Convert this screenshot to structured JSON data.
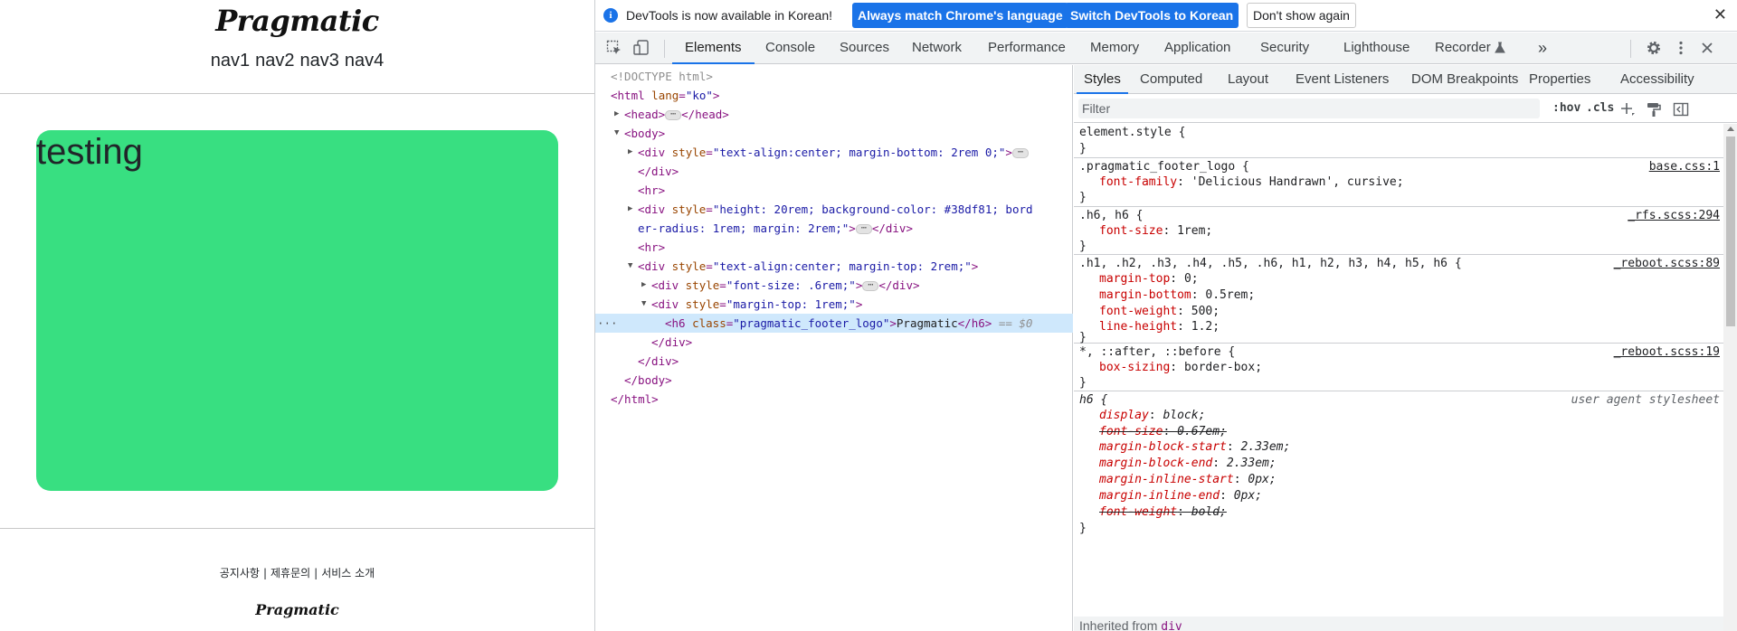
{
  "page": {
    "logo_top": "Pragmatic",
    "nav": [
      "nav1",
      "nav2",
      "nav3",
      "nav4"
    ],
    "box_text": "testing",
    "box_color": "#38df81",
    "footer_links": [
      "공지사항",
      "제휴문의",
      "서비스 소개"
    ],
    "footer_separator": "|",
    "logo_bottom": "Pragmatic"
  },
  "devtools": {
    "infobar": {
      "message": "DevTools is now available in Korean!",
      "btn_match": "Always match Chrome's language",
      "btn_switch": "Switch DevTools to Korean",
      "btn_dismiss": "Don't show again",
      "close": "✕"
    },
    "tabs": [
      "Elements",
      "Console",
      "Sources",
      "Network",
      "Performance",
      "Memory",
      "Application",
      "Security",
      "Lighthouse",
      "Recorder"
    ],
    "more_tabs": "»",
    "elements_tree": {
      "doctype": "<!DOCTYPE html>",
      "html_open_tag": "<html",
      "html_lang_attr": "lang",
      "html_lang_val": "\"ko\"",
      "head": "<head>",
      "head_close": "</head>",
      "body": "<body>",
      "div1_tag": "<div",
      "div1_attr": "style",
      "div1_val": "\"text-align:center; margin-bottom: 2rem 0;\"",
      "div_close": "</div>",
      "hr": "<hr>",
      "div2_val_1": "\"height: 20rem; background-color: #38df81; bord",
      "div2_val_2": "er-radius: 1rem; margin: 2rem;\"",
      "div3_val": "\"text-align:center; margin-top: 2rem;\"",
      "div4_val": "\"font-size: .6rem;\"",
      "div5_val": "\"margin-top: 1rem;\"",
      "h6_tag": "<h6",
      "h6_attr": "class",
      "h6_class": "\"pragmatic_footer_logo\"",
      "h6_text": "Pragmatic",
      "h6_close": "</h6>",
      "h6_marker": "== $0",
      "body_close": "</body>",
      "html_close": "</html>",
      "row_dots": "···"
    },
    "styles_tabs": [
      "Styles",
      "Computed",
      "Layout",
      "Event Listeners",
      "DOM Breakpoints",
      "Properties",
      "Accessibility"
    ],
    "filter_placeholder": "Filter",
    "hov": ":hov",
    "cls": ".cls",
    "rules": [
      {
        "selector": "element.style {",
        "source": "",
        "decls": []
      },
      {
        "selector": ".pragmatic_footer_logo {",
        "source": "base.css:1",
        "decls": [
          {
            "p": "font-family",
            "v": "'Delicious Handrawn', cursive;"
          }
        ]
      },
      {
        "selector": ".h6, h6 {",
        "source": "_rfs.scss:294",
        "decls": [
          {
            "p": "font-size",
            "v": "1rem;"
          }
        ]
      },
      {
        "selector": ".h1, .h2, .h3, .h4, .h5, .h6, h1, h2, h3, h4, h5, h6 {",
        "source": "_reboot.scss:89",
        "decls": [
          {
            "p": "margin-top",
            "v": "0;"
          },
          {
            "p": "margin-bottom",
            "v": "0.5rem;"
          },
          {
            "p": "font-weight",
            "v": "500;"
          },
          {
            "p": "line-height",
            "v": "1.2;"
          }
        ]
      },
      {
        "selector": "*, ::after, ::before {",
        "source": "_reboot.scss:19",
        "decls": [
          {
            "p": "box-sizing",
            "v": "border-box;"
          }
        ]
      },
      {
        "selector": "h6 {",
        "source": "user agent stylesheet",
        "decls": [
          {
            "p": "display",
            "v": "block;"
          },
          {
            "p": "font-size",
            "v": "0.67em;"
          },
          {
            "p": "margin-block-start",
            "v": "2.33em;"
          },
          {
            "p": "margin-block-end",
            "v": "2.33em;"
          },
          {
            "p": "margin-inline-start",
            "v": "0px;"
          },
          {
            "p": "margin-inline-end",
            "v": "0px;"
          },
          {
            "p": "font-weight",
            "v": "bold;"
          }
        ]
      }
    ],
    "close_brace": "}",
    "inherited_label": "Inherited from",
    "inherited_tag": "div"
  }
}
